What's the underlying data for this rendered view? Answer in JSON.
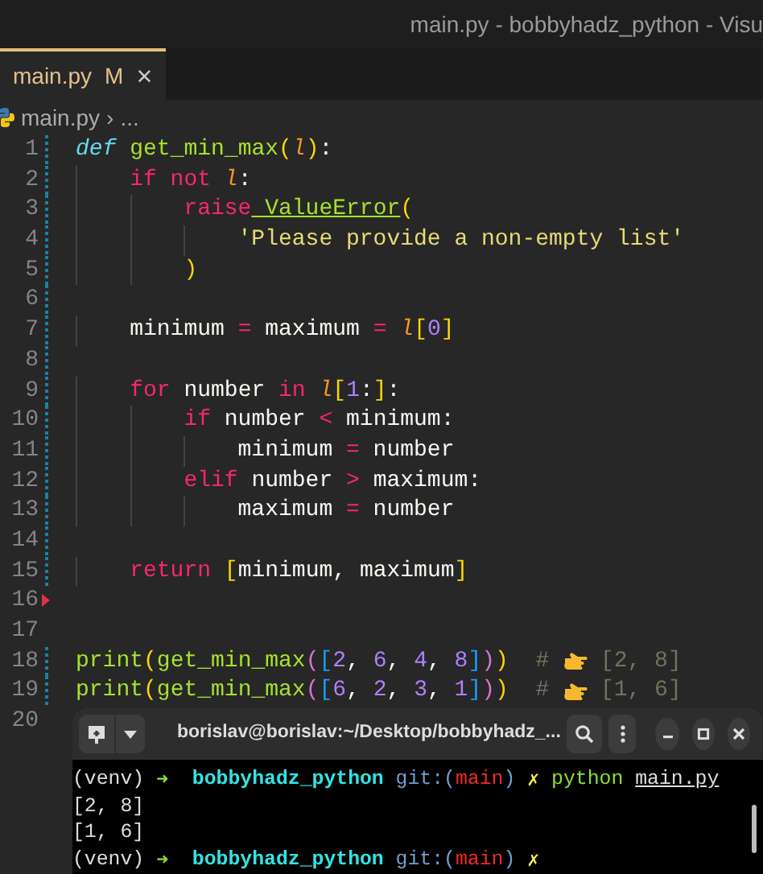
{
  "window": {
    "title": "main.py - bobbyhadz_python - Visu"
  },
  "tabs": [
    {
      "label": "main.py",
      "status": "M",
      "close": "×",
      "selected": true
    }
  ],
  "breadcrumb": [
    "main.py",
    "›",
    "..."
  ],
  "editor": {
    "lines": [
      {
        "number": "1",
        "changed": true,
        "marker": false,
        "tokens": [
          {
            "kind": "def",
            "text": "def"
          },
          {
            "kind": "fn",
            "text": " get_min_max"
          },
          {
            "kind": "b1",
            "text": "("
          },
          {
            "kind": "param",
            "text": "l"
          },
          {
            "kind": "b1",
            "text": ")"
          },
          {
            "kind": "plain",
            "text": ":"
          }
        ]
      },
      {
        "number": "2",
        "changed": true,
        "marker": false,
        "tokens": [
          {
            "kind": "kw",
            "text": "    if"
          },
          {
            "kind": "kw",
            "text": " not"
          },
          {
            "kind": "param",
            "text": " l"
          },
          {
            "kind": "plain",
            "text": ":"
          }
        ]
      },
      {
        "number": "3",
        "changed": true,
        "marker": false,
        "tokens": [
          {
            "kind": "kw",
            "text": "        raise"
          },
          {
            "kind": "cls",
            "text": " ValueError"
          },
          {
            "kind": "b1",
            "text": "("
          }
        ]
      },
      {
        "number": "4",
        "changed": true,
        "marker": false,
        "tokens": [
          {
            "kind": "str",
            "text": "            'Please provide a non-empty list'"
          }
        ]
      },
      {
        "number": "5",
        "changed": true,
        "marker": false,
        "tokens": [
          {
            "kind": "b1",
            "text": "        )"
          }
        ]
      },
      {
        "number": "6",
        "changed": true,
        "marker": false
      },
      {
        "number": "7",
        "changed": true,
        "marker": false,
        "tokens": [
          {
            "kind": "plain",
            "text": "    minimum "
          },
          {
            "kind": "op",
            "text": "="
          },
          {
            "kind": "plain",
            "text": " maximum "
          },
          {
            "kind": "op",
            "text": "="
          },
          {
            "kind": "param",
            "text": " l"
          },
          {
            "kind": "b1",
            "text": "["
          },
          {
            "kind": "num",
            "text": "0"
          },
          {
            "kind": "b1",
            "text": "]"
          }
        ]
      },
      {
        "number": "8",
        "changed": true,
        "marker": false
      },
      {
        "number": "9",
        "changed": true,
        "marker": false,
        "tokens": [
          {
            "kind": "kw",
            "text": "    for"
          },
          {
            "kind": "plain",
            "text": " number "
          },
          {
            "kind": "kw",
            "text": "in"
          },
          {
            "kind": "param",
            "text": " l"
          },
          {
            "kind": "b1",
            "text": "["
          },
          {
            "kind": "num",
            "text": "1"
          },
          {
            "kind": "plain",
            "text": ":"
          },
          {
            "kind": "b1",
            "text": "]"
          },
          {
            "kind": "plain",
            "text": ":"
          }
        ]
      },
      {
        "number": "10",
        "changed": true,
        "marker": false,
        "tokens": [
          {
            "kind": "kw",
            "text": "        if"
          },
          {
            "kind": "plain",
            "text": " number "
          },
          {
            "kind": "op",
            "text": "<"
          },
          {
            "kind": "plain",
            "text": " minimum:"
          }
        ]
      },
      {
        "number": "11",
        "changed": true,
        "marker": false,
        "tokens": [
          {
            "kind": "plain",
            "text": "            minimum "
          },
          {
            "kind": "op",
            "text": "="
          },
          {
            "kind": "plain",
            "text": " number"
          }
        ]
      },
      {
        "number": "12",
        "changed": true,
        "marker": false,
        "tokens": [
          {
            "kind": "kw",
            "text": "        elif"
          },
          {
            "kind": "plain",
            "text": " number "
          },
          {
            "kind": "op",
            "text": ">"
          },
          {
            "kind": "plain",
            "text": " maximum:"
          }
        ]
      },
      {
        "number": "13",
        "changed": true,
        "marker": false,
        "tokens": [
          {
            "kind": "plain",
            "text": "            maximum "
          },
          {
            "kind": "op",
            "text": "="
          },
          {
            "kind": "plain",
            "text": " number"
          }
        ]
      },
      {
        "number": "14",
        "changed": true,
        "marker": false
      },
      {
        "number": "15",
        "changed": true,
        "marker": false,
        "tokens": [
          {
            "kind": "kw",
            "text": "    return"
          },
          {
            "kind": "b1",
            "text": " ["
          },
          {
            "kind": "plain",
            "text": "minimum, maximum"
          },
          {
            "kind": "b1",
            "text": "]"
          }
        ]
      },
      {
        "number": "16",
        "changed": false,
        "marker": true
      },
      {
        "number": "17",
        "changed": false,
        "marker": false
      },
      {
        "number": "18",
        "changed": true,
        "marker": false,
        "tokens": [
          {
            "kind": "fn",
            "text": "print"
          },
          {
            "kind": "b1",
            "text": "("
          },
          {
            "kind": "fn",
            "text": "get_min_max"
          },
          {
            "kind": "b2",
            "text": "("
          },
          {
            "kind": "b3",
            "text": "["
          },
          {
            "kind": "num",
            "text": "2"
          },
          {
            "kind": "plain",
            "text": ","
          },
          {
            "kind": "num",
            "text": " 6"
          },
          {
            "kind": "plain",
            "text": ","
          },
          {
            "kind": "num",
            "text": " 4"
          },
          {
            "kind": "plain",
            "text": ","
          },
          {
            "kind": "num",
            "text": " 8"
          },
          {
            "kind": "b3",
            "text": "]"
          },
          {
            "kind": "b2",
            "text": ")"
          },
          {
            "kind": "b1",
            "text": ")"
          },
          {
            "kind": "comment",
            "text": "  # "
          },
          {
            "kind": "hand"
          },
          {
            "kind": "comment",
            "text": " [2, 8]"
          }
        ]
      },
      {
        "number": "19",
        "changed": true,
        "marker": false,
        "tokens": [
          {
            "kind": "fn",
            "text": "print"
          },
          {
            "kind": "b1",
            "text": "("
          },
          {
            "kind": "fn",
            "text": "get_min_max"
          },
          {
            "kind": "b2",
            "text": "("
          },
          {
            "kind": "b3",
            "text": "["
          },
          {
            "kind": "num",
            "text": "6"
          },
          {
            "kind": "plain",
            "text": ","
          },
          {
            "kind": "num",
            "text": " 2"
          },
          {
            "kind": "plain",
            "text": ","
          },
          {
            "kind": "num",
            "text": " 3"
          },
          {
            "kind": "plain",
            "text": ","
          },
          {
            "kind": "num",
            "text": " 1"
          },
          {
            "kind": "b3",
            "text": "]"
          },
          {
            "kind": "b2",
            "text": ")"
          },
          {
            "kind": "b1",
            "text": ")"
          },
          {
            "kind": "comment",
            "text": "  # "
          },
          {
            "kind": "hand"
          },
          {
            "kind": "comment",
            "text": " [1, 6]"
          }
        ]
      },
      {
        "number": "20",
        "changed": false,
        "marker": false
      }
    ]
  },
  "terminal": {
    "title": "borislav@borislav:~/Desktop/bobbyhadz_...",
    "lines": [
      [
        {
          "kind": "plain",
          "text": "(venv) "
        },
        {
          "kind": "arrow",
          "text": "➜"
        },
        {
          "kind": "dir",
          "text": "  bobbyhadz_python"
        },
        {
          "kind": "git",
          "text": " git:("
        },
        {
          "kind": "branch",
          "text": "main"
        },
        {
          "kind": "git",
          "text": ")"
        },
        {
          "kind": "dirty",
          "text": " ✗"
        },
        {
          "kind": "cmd",
          "text": " python "
        },
        {
          "kind": "file",
          "text": "main.py"
        }
      ],
      [
        {
          "kind": "plain",
          "text": "[2, 8]"
        }
      ],
      [
        {
          "kind": "plain",
          "text": "[1, 6]"
        }
      ],
      [
        {
          "kind": "plain",
          "text": "(venv) "
        },
        {
          "kind": "arrow",
          "text": "➜"
        },
        {
          "kind": "dir",
          "text": "  bobbyhadz_python"
        },
        {
          "kind": "git",
          "text": " git:("
        },
        {
          "kind": "branch",
          "text": "main"
        },
        {
          "kind": "git",
          "text": ")"
        },
        {
          "kind": "dirty",
          "text": " ✗"
        }
      ]
    ]
  }
}
